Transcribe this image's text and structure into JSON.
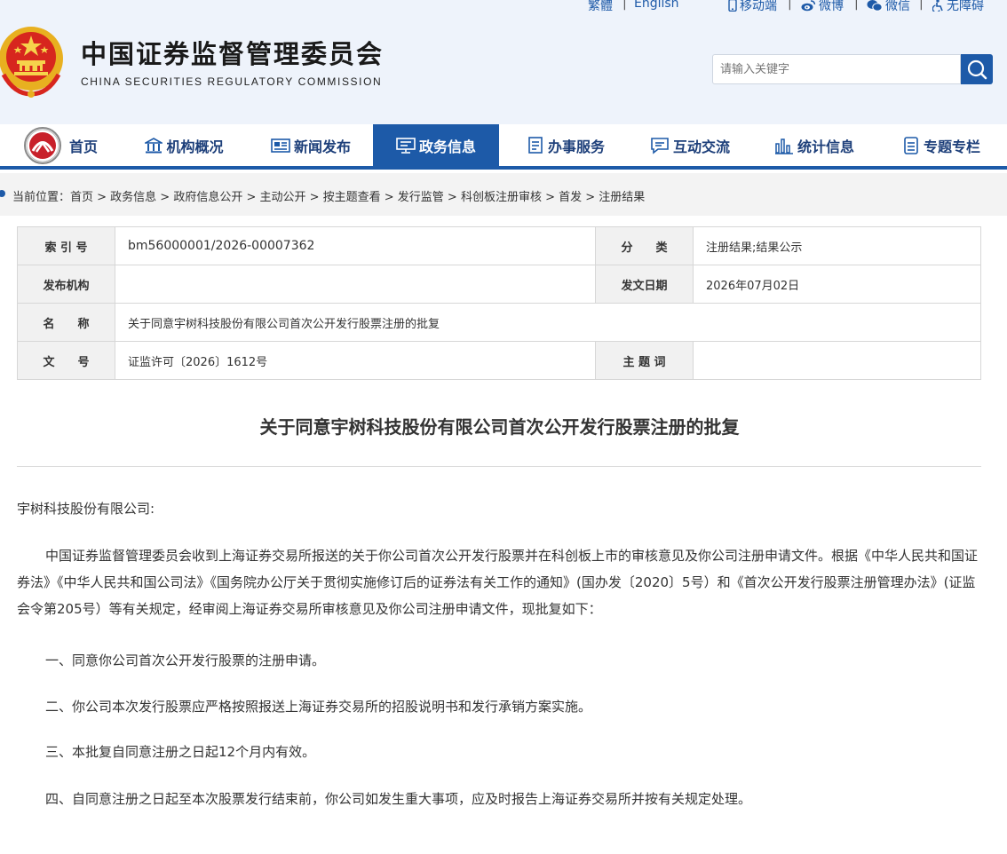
{
  "header": {
    "top_links": {
      "traditional": "繁體",
      "english": "English",
      "mobile": "移动端",
      "weibo": "微博",
      "wechat": "微信",
      "accessibility": "无障碍"
    },
    "title_cn": "中国证券监督管理委员会",
    "title_en": "CHINA SECURITIES REGULATORY COMMISSION",
    "search_placeholder": "请输入关键字"
  },
  "nav": [
    {
      "label": "首页",
      "icon": "home-logo"
    },
    {
      "label": "机构概况",
      "icon": "building-icon"
    },
    {
      "label": "新闻发布",
      "icon": "news-icon"
    },
    {
      "label": "政务信息",
      "icon": "monitor-icon",
      "active": true
    },
    {
      "label": "办事服务",
      "icon": "document-icon"
    },
    {
      "label": "互动交流",
      "icon": "chat-icon"
    },
    {
      "label": "统计信息",
      "icon": "bar-chart-icon"
    },
    {
      "label": "专题专栏",
      "icon": "folder-icon"
    }
  ],
  "breadcrumb": "当前位置：首页 > 政务信息 > 政府信息公开 > 主动公开 > 按主题查看 > 发行监管 > 科创板注册审核 > 首发 > 注册结果",
  "meta": {
    "index_label": "索 引 号",
    "index_value": "bm56000001/2026-00007362",
    "category_label": "分　　类",
    "category_value": "注册结果;结果公示",
    "publisher_label": "发布机构",
    "publisher_value": "",
    "date_label": "发文日期",
    "date_value": "2026年07月02日",
    "name_label": "名　　称",
    "name_value": "关于同意宇树科技股份有限公司首次公开发行股票注册的批复",
    "docno_label": "文　　号",
    "docno_value": "证监许可〔2026〕1612号",
    "keywords_label": "主 题 词",
    "keywords_value": ""
  },
  "article": {
    "title": "关于同意宇树科技股份有限公司首次公开发行股票注册的批复",
    "salutation": "宇树科技股份有限公司:",
    "para1": "中国证券监督管理委员会收到上海证券交易所报送的关于你公司首次公开发行股票并在科创板上市的审核意见及你公司注册申请文件。根据《中华人民共和国证券法》《中华人民共和国公司法》《国务院办公厅关于贯彻实施修订后的证券法有关工作的通知》(国办发〔2020〕5号）和《首次公开发行股票注册管理办法》(证监会令第205号）等有关规定，经审阅上海证券交易所审核意见及你公司注册申请文件，现批复如下：",
    "item1": "一、同意你公司首次公开发行股票的注册申请。",
    "item2": "二、你公司本次发行股票应严格按照报送上海证券交易所的招股说明书和发行承销方案实施。",
    "item3": "三、本批复自同意注册之日起12个月内有效。",
    "item4": "四、自同意注册之日起至本次股票发行结束前，你公司如发生重大事项，应及时报告上海证券交易所并按有关规定处理。"
  },
  "colors": {
    "brand_blue": "#1d5aa8",
    "nav_text": "#1d3f7a",
    "header_bg": "#eef3fb"
  }
}
